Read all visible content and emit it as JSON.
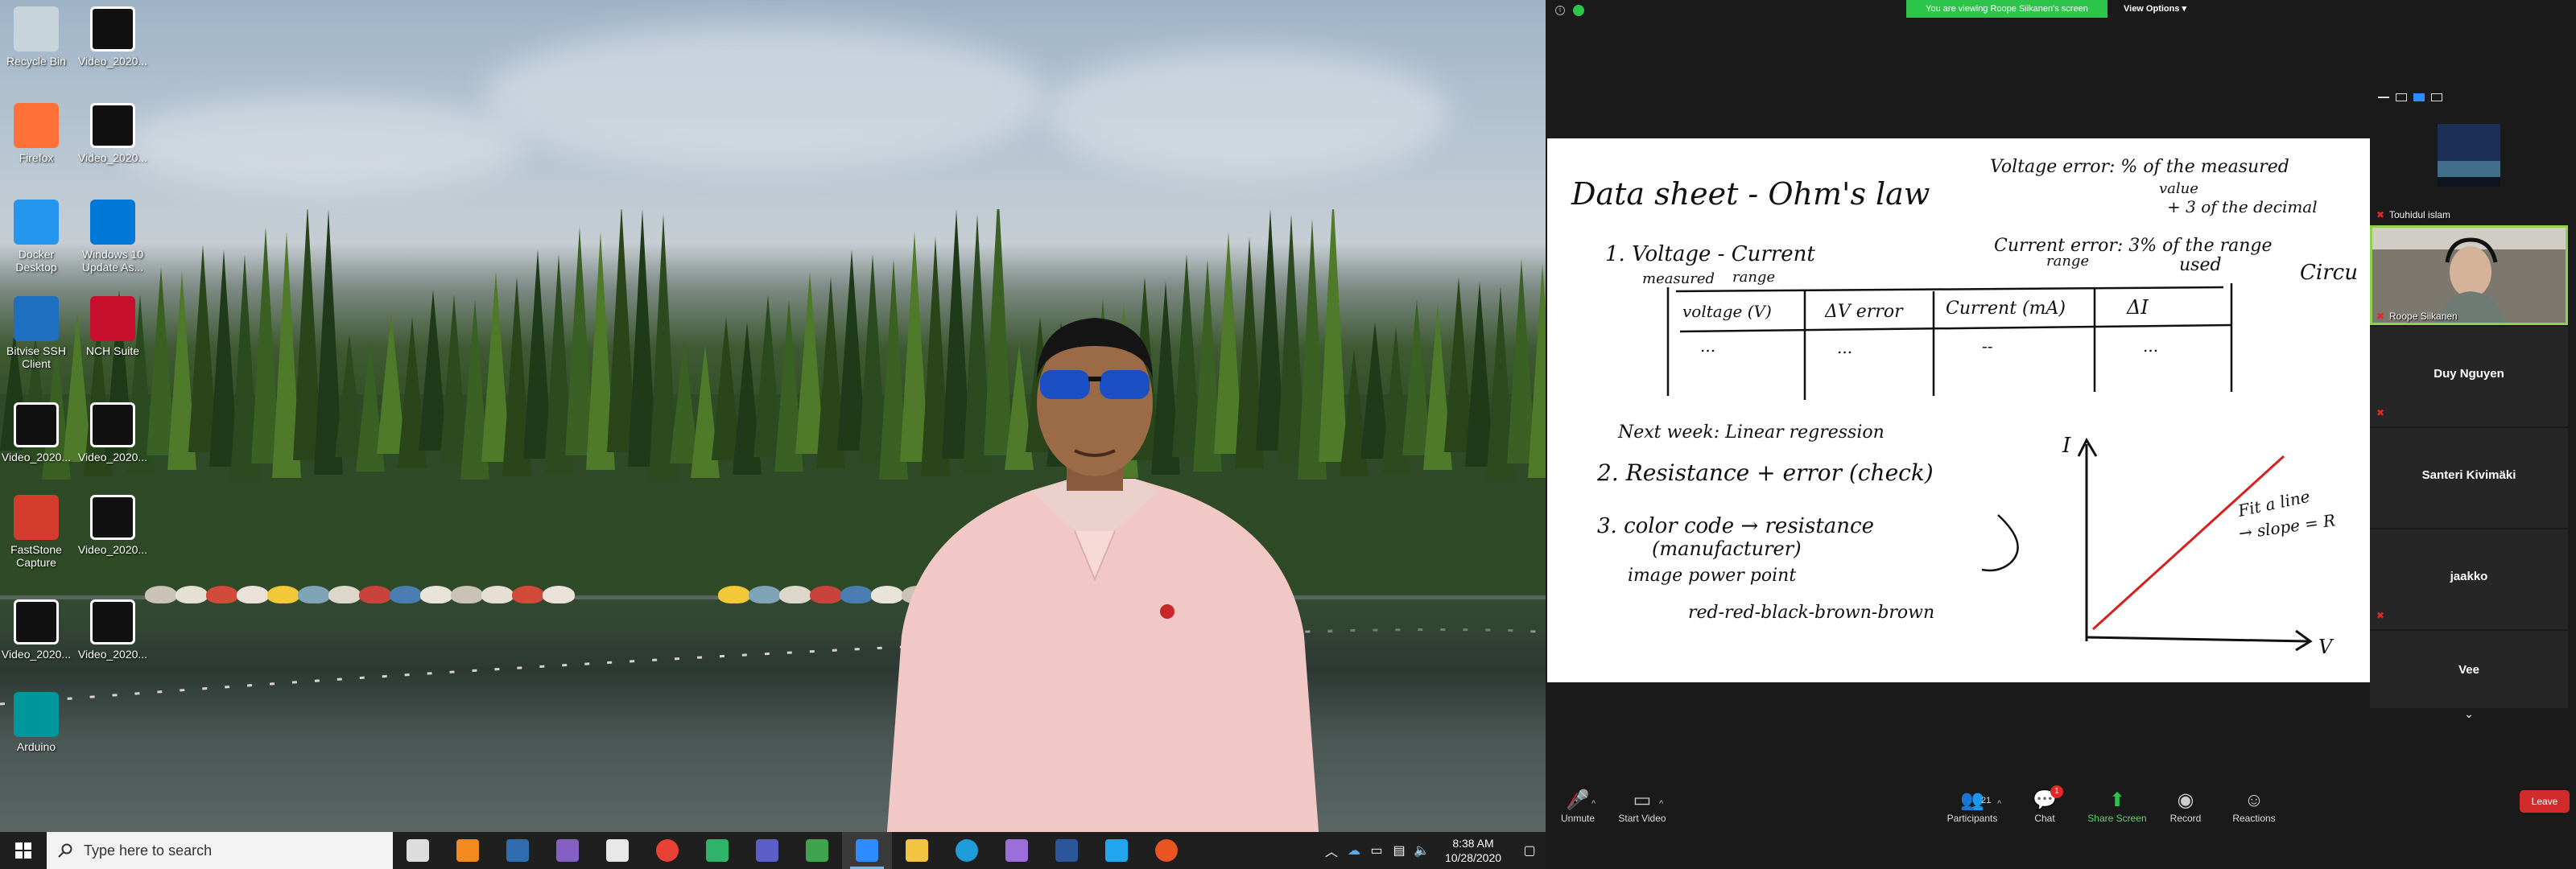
{
  "desktop": {
    "icons": [
      {
        "label": "Recycle Bin",
        "icon": "recycle-bin-icon",
        "color": "#c8d4dc"
      },
      {
        "label": "Video_2020...",
        "icon": "video-file-icon",
        "color": "#ffffff"
      },
      {
        "label": "Firefox",
        "icon": "firefox-icon",
        "color": "#ff7139"
      },
      {
        "label": "Video_2020...",
        "icon": "video-file-icon",
        "color": "#ffffff"
      },
      {
        "label": "Docker Desktop",
        "icon": "docker-icon",
        "color": "#2496ed"
      },
      {
        "label": "Windows 10 Update As...",
        "icon": "windows-update-icon",
        "color": "#0078d7"
      },
      {
        "label": "Bitvise SSH Client",
        "icon": "bitvise-icon",
        "color": "#1f6fc1"
      },
      {
        "label": "NCH Suite",
        "icon": "nch-icon",
        "color": "#c8102e"
      },
      {
        "label": "Video_2020...",
        "icon": "video-file-icon",
        "color": "#ffffff"
      },
      {
        "label": "Video_2020...",
        "icon": "video-file-icon",
        "color": "#ffffff"
      },
      {
        "label": "FastStone Capture",
        "icon": "faststone-icon",
        "color": "#d33b2c"
      },
      {
        "label": "Video_2020...",
        "icon": "video-file-icon",
        "color": "#ffffff"
      },
      {
        "label": "Video_2020...",
        "icon": "video-file-icon",
        "color": "#ffffff"
      },
      {
        "label": "Video_2020...",
        "icon": "video-file-icon",
        "color": "#ffffff"
      },
      {
        "label": "Arduino",
        "icon": "arduino-icon",
        "color": "#00979c"
      }
    ]
  },
  "taskbar": {
    "search_placeholder": "Type here to search",
    "apps": [
      {
        "name": "task-view-icon",
        "color": "#dddddd"
      },
      {
        "name": "sticky-app-icon",
        "color": "#f28a1e"
      },
      {
        "name": "vmware-icon",
        "color": "#2f6db0"
      },
      {
        "name": "visual-studio-icon",
        "color": "#865fc5"
      },
      {
        "name": "store-icon",
        "color": "#e8e8e8"
      },
      {
        "name": "chrome-icon",
        "color": "#e94235"
      },
      {
        "name": "sourcetree-icon",
        "color": "#2fb36a"
      },
      {
        "name": "teams-icon",
        "color": "#5b5fc7"
      },
      {
        "name": "git-tool-icon",
        "color": "#3fa34d"
      },
      {
        "name": "zoom-icon",
        "color": "#2d8cff"
      },
      {
        "name": "file-explorer-icon",
        "color": "#f3c442"
      },
      {
        "name": "edge-icon",
        "color": "#1f9ddb"
      },
      {
        "name": "pen-app-icon",
        "color": "#9b6ed9"
      },
      {
        "name": "word-icon",
        "color": "#2b579a"
      },
      {
        "name": "vscode-icon",
        "color": "#23a6f0"
      },
      {
        "name": "ubuntu-icon",
        "color": "#e95420"
      }
    ],
    "time": "8:38 AM",
    "date": "10/28/2020"
  },
  "zoom": {
    "banner": "You are viewing Roope Siikanen's screen",
    "view_options": "View Options",
    "whiteboard": {
      "title": "Data sheet - Ohm's law",
      "item1": "1. Voltage - Current",
      "measured": "measured",
      "range": "range",
      "table_headers": [
        "voltage (V)",
        "ΔV error",
        "Current (mA)",
        "ΔI"
      ],
      "table_cells": [
        "...",
        "...",
        "--",
        "..."
      ],
      "next_week": "Next week: Linear regression",
      "item2": "2. Resistance + error (check)",
      "item3": "3. color code → resistance",
      "manufacturer": "(manufacturer)",
      "image_pp": "image power point",
      "colors": "red-red-black-brown-brown",
      "voltage_error_1": "Voltage error: % of the measured",
      "voltage_error_2": "value",
      "voltage_error_3": "+ 3 of the decimal",
      "current_error_1": "Current error: 3% of the range",
      "current_error_2": "range",
      "current_error_3": "used",
      "fit_line": "Fit a line",
      "slope": "→ slope = R",
      "axis_i": "I",
      "axis_v": "V",
      "circ": "Circu"
    },
    "participants": [
      {
        "name": "Touhidul islam",
        "type": "video"
      },
      {
        "name": "Roope Siikanen",
        "type": "video"
      },
      {
        "name": "Duy Nguyen",
        "type": "name"
      },
      {
        "name": "Santeri Kivimäki",
        "type": "name"
      },
      {
        "name": "jaakko",
        "type": "name"
      },
      {
        "name": "Vee",
        "type": "name"
      }
    ],
    "toolbar": {
      "unmute": "Unmute",
      "start_video": "Start Video",
      "participants": "Participants",
      "participants_count": "21",
      "chat": "Chat",
      "chat_badge": "1",
      "share_screen": "Share Screen",
      "record": "Record",
      "reactions": "Reactions",
      "leave": "Leave"
    }
  }
}
